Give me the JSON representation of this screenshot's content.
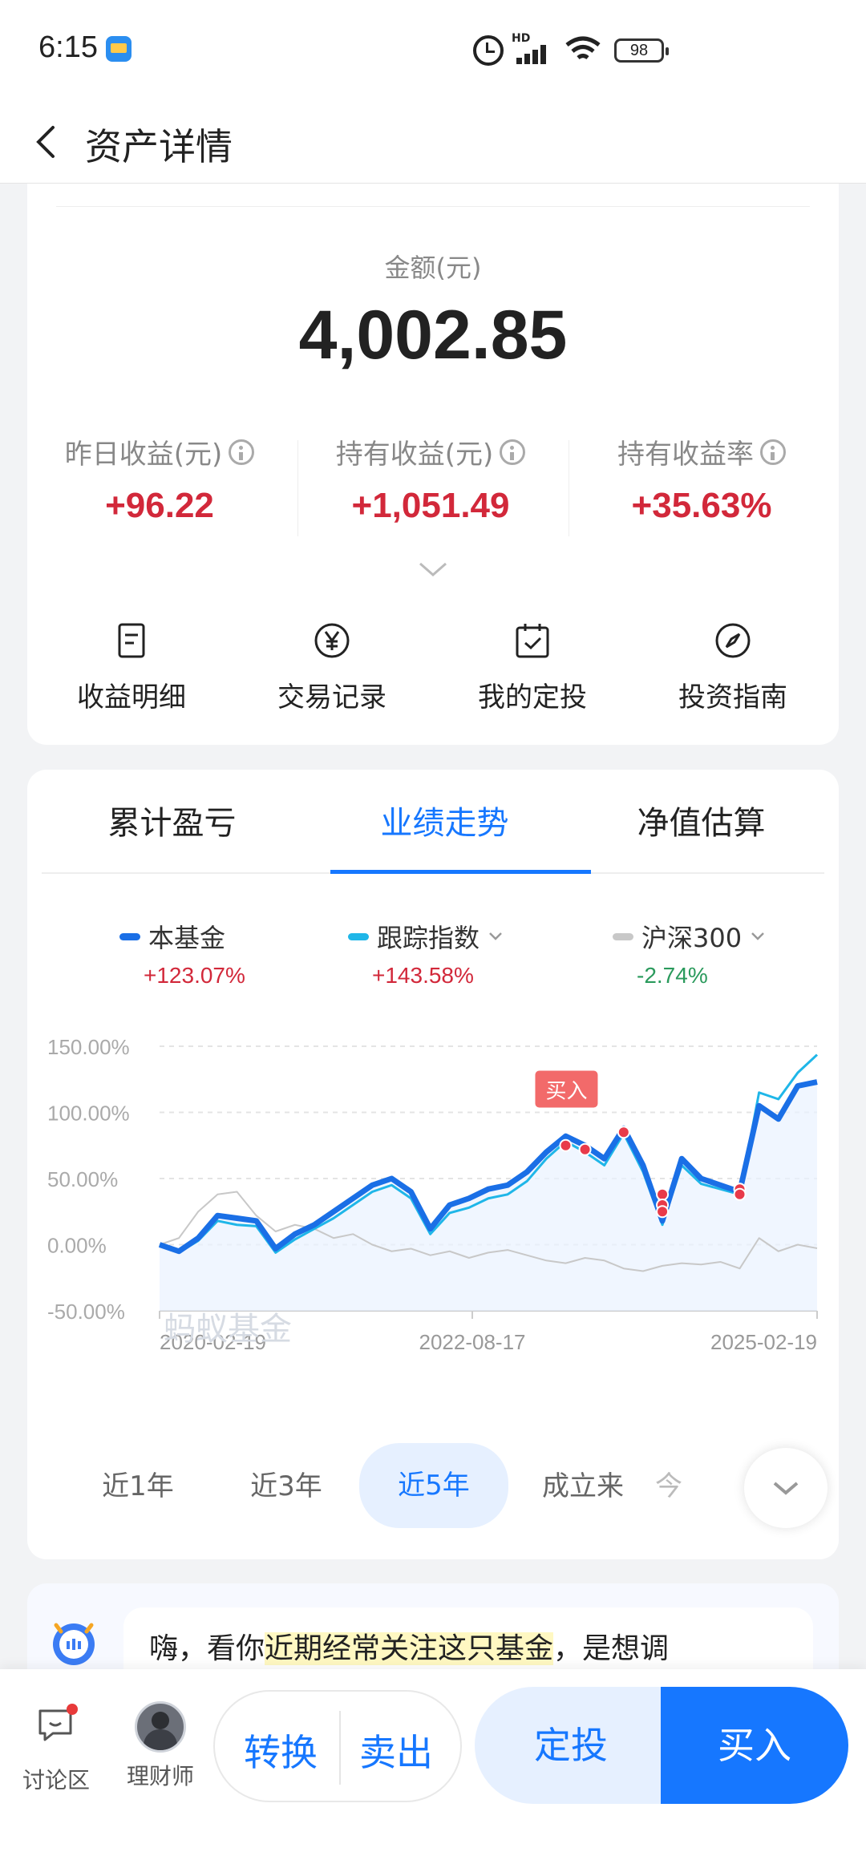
{
  "status_bar": {
    "time": "6:15",
    "network": "HD",
    "battery": "98"
  },
  "nav": {
    "title": "资产详情"
  },
  "asset": {
    "amount_label": "金额(元)",
    "amount": "4,002.85",
    "stats": [
      {
        "label": "昨日收益(元)",
        "value": "+96.22"
      },
      {
        "label": "持有收益(元)",
        "value": "+1,051.49"
      },
      {
        "label": "持有收益率",
        "value": "+35.63%"
      }
    ],
    "actions": [
      {
        "label": "收益明细",
        "icon": "document-icon"
      },
      {
        "label": "交易记录",
        "icon": "yen-circle-icon"
      },
      {
        "label": "我的定投",
        "icon": "calendar-check-icon"
      },
      {
        "label": "投资指南",
        "icon": "compass-icon"
      }
    ]
  },
  "perf": {
    "tabs": [
      "累计盈亏",
      "业绩走势",
      "净值估算"
    ],
    "active_tab": "业绩走势",
    "legend": [
      {
        "name": "本基金",
        "value": "+123.07%",
        "color": "#1a6fe6",
        "value_color": "#d2283a"
      },
      {
        "name": "跟踪指数",
        "value": "+143.58%",
        "color": "#1fb6e8",
        "value_color": "#d2283a"
      },
      {
        "name": "沪深300",
        "value": "-2.74%",
        "color": "#c8c8c8",
        "value_color": "#2a9a5c"
      }
    ],
    "watermark": "蚂蚁基金",
    "buy_marker_label": "买入",
    "periods": [
      "近1年",
      "近3年",
      "近5年",
      "成立来",
      "今"
    ],
    "active_period": "近5年"
  },
  "chart_data": {
    "type": "line",
    "x_ticks": [
      "2020-02-19",
      "2022-08-17",
      "2025-02-19"
    ],
    "y_ticks": [
      "150.00%",
      "100.00%",
      "50.00%",
      "0.00%",
      "-50.00%"
    ],
    "ylim": [
      -50,
      150
    ],
    "series": [
      {
        "name": "本基金",
        "color": "#1a6fe6",
        "values": [
          0,
          -5,
          5,
          22,
          20,
          18,
          -3,
          8,
          15,
          25,
          35,
          45,
          50,
          40,
          12,
          30,
          35,
          42,
          45,
          55,
          70,
          82,
          75,
          65,
          88,
          60,
          18,
          65,
          50,
          45,
          40,
          105,
          95,
          120,
          123
        ]
      },
      {
        "name": "跟踪指数",
        "color": "#1fb6e8",
        "values": [
          0,
          -6,
          3,
          18,
          15,
          14,
          -6,
          4,
          12,
          20,
          30,
          40,
          45,
          35,
          8,
          24,
          28,
          35,
          38,
          48,
          65,
          78,
          70,
          60,
          84,
          55,
          15,
          60,
          46,
          42,
          38,
          115,
          110,
          130,
          143.6
        ]
      },
      {
        "name": "沪深300",
        "color": "#c8c8c8",
        "values": [
          0,
          5,
          25,
          38,
          40,
          22,
          10,
          15,
          12,
          5,
          8,
          0,
          -5,
          -3,
          -8,
          -5,
          -10,
          -6,
          -4,
          -8,
          -12,
          -14,
          -10,
          -12,
          -18,
          -20,
          -16,
          -14,
          -15,
          -13,
          -18,
          5,
          -5,
          0,
          -2.7
        ]
      }
    ],
    "buy_points": [
      {
        "x_index": 21,
        "value": 75
      },
      {
        "x_index": 22,
        "value": 72
      },
      {
        "x_index": 24,
        "value": 85
      },
      {
        "x_index": 26,
        "value": 38
      },
      {
        "x_index": 26,
        "value": 30
      },
      {
        "x_index": 26,
        "value": 25
      },
      {
        "x_index": 30,
        "value": 42
      },
      {
        "x_index": 30,
        "value": 38
      }
    ]
  },
  "assistant": {
    "text_before": "嗨，看你",
    "text_highlight": "近期经常关注这只基金",
    "text_after": "，是想调"
  },
  "bottom_bar": {
    "discuss_label": "讨论区",
    "advisor_label": "理财师",
    "convert_label": "转换",
    "sell_label": "卖出",
    "dingtou_label": "定投",
    "buy_label": "买入"
  }
}
